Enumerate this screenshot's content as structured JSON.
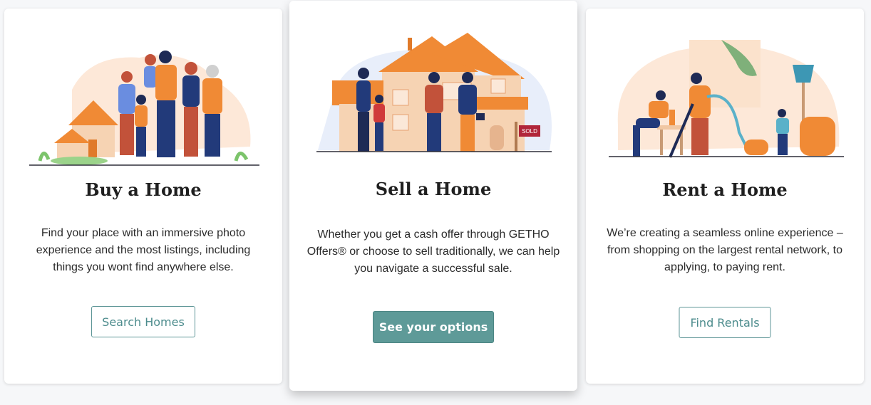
{
  "cards": [
    {
      "title": "Buy a Home",
      "description": "Find your place with an immersive photo experience and the most listings, including things you wont find anywhere else.",
      "button_label": "Search Homes"
    },
    {
      "title": "Sell a Home",
      "description": "Whether you get a cash offer through GETHO Offers® or choose to sell traditionally, we can help you navigate a successful sale.",
      "button_label": "See your options",
      "sign_text": "SOLD"
    },
    {
      "title": "Rent a Home",
      "description": "We’re creating a seamless online experience – from shopping on the largest rental network, to applying, to paying rent.",
      "button_label": "Find Rentals"
    }
  ],
  "colors": {
    "accent": "#5e9a98",
    "orange": "#f08a35",
    "navy": "#223a7a",
    "peach_bg": "#fde8d8"
  },
  "icons": [
    "family-illustration",
    "house-sale-illustration",
    "rental-cleaning-illustration"
  ]
}
